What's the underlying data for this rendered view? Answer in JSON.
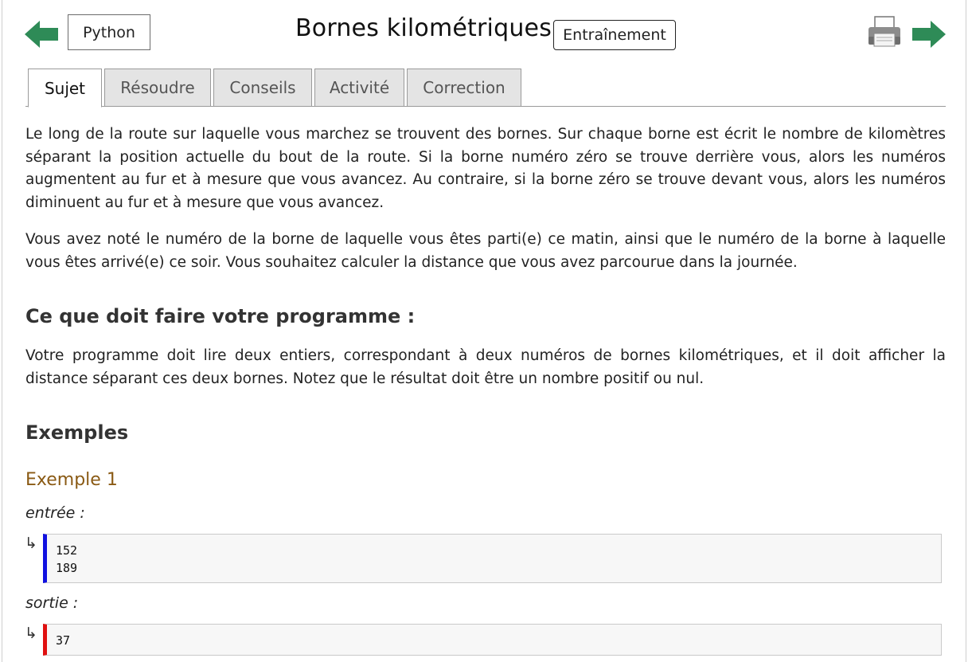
{
  "header": {
    "language_button": "Python",
    "title": "Bornes kilométriques",
    "mode_badge": "Entraînement",
    "icons": {
      "prev": "left-arrow-icon",
      "next": "right-arrow-icon",
      "print": "printer-icon"
    },
    "accent_color": "#2e8b57"
  },
  "tabs": [
    {
      "label": "Sujet",
      "active": true
    },
    {
      "label": "Résoudre",
      "active": false
    },
    {
      "label": "Conseils",
      "active": false
    },
    {
      "label": "Activité",
      "active": false
    },
    {
      "label": "Correction",
      "active": false
    }
  ],
  "content": {
    "intro_paragraphs": [
      "Le long de la route sur laquelle vous marchez se trouvent des bornes. Sur chaque borne est écrit le nombre de kilomètres séparant la position actuelle du bout de la route. Si la borne numéro zéro se trouve derrière vous, alors les numéros augmentent au fur et à mesure que vous avancez. Au contraire, si la borne zéro se trouve devant vous, alors les numéros diminuent au fur et à mesure que vous avancez.",
      "Vous avez noté le numéro de la borne de laquelle vous êtes parti(e) ce matin, ainsi que le numéro de la borne à laquelle vous êtes arrivé(e) ce soir. Vous souhaitez calculer la distance que vous avez parcourue dans la journée."
    ],
    "program_heading": "Ce que doit faire votre programme :",
    "program_text": "Votre programme doit lire deux entiers, correspondant à deux numéros de bornes kilométriques, et il doit afficher la distance séparant ces deux bornes. Notez que le résultat doit être un nombre positif ou nul.",
    "examples_heading": "Exemples",
    "example1": {
      "heading": "Exemple 1",
      "input_label": "entrée :",
      "input_lines": [
        "152",
        "189"
      ],
      "output_label": "sortie :",
      "output_lines": [
        "37"
      ],
      "arrow_glyph": "↳"
    }
  }
}
